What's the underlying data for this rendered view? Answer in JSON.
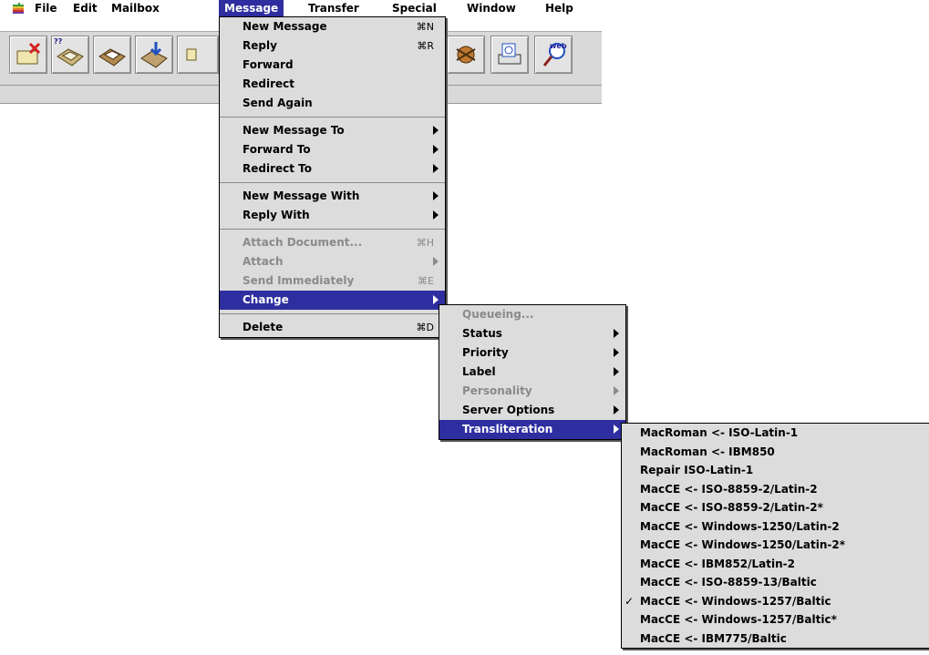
{
  "menubar": {
    "apple_icon": "apple-icon",
    "items": [
      "File",
      "Edit",
      "Mailbox",
      "Message",
      "Transfer",
      "Special",
      "Window",
      "Help"
    ],
    "active": "Message"
  },
  "toolbar": {
    "buttons": [
      {
        "icon": "trash-message-icon",
        "tag": ""
      },
      {
        "icon": "mailbox-icon",
        "tag": "??"
      },
      {
        "icon": "in-tray-icon",
        "tag": ""
      },
      {
        "icon": "download-icon",
        "tag": ""
      },
      {
        "icon": "partial-icon",
        "tag": ""
      },
      {
        "icon": "tool-icon",
        "tag": ""
      },
      {
        "icon": "preview-icon",
        "tag": ""
      },
      {
        "icon": "web-search-icon",
        "tag": "web"
      }
    ]
  },
  "message_menu": {
    "items": [
      {
        "label": "New Message",
        "shortcut": "⌘N"
      },
      {
        "label": "Reply",
        "shortcut": "⌘R"
      },
      {
        "label": "Forward",
        "shortcut": ""
      },
      {
        "label": "Redirect",
        "shortcut": ""
      },
      {
        "label": "Send Again",
        "shortcut": ""
      },
      {
        "label": "New Message To",
        "submenu": true
      },
      {
        "label": "Forward To",
        "submenu": true
      },
      {
        "label": "Redirect To",
        "submenu": true
      },
      {
        "label": "New Message With",
        "submenu": true
      },
      {
        "label": "Reply With",
        "submenu": true
      },
      {
        "label": "Attach Document...",
        "shortcut": "⌘H",
        "disabled": true
      },
      {
        "label": "Attach",
        "submenu": true,
        "disabled": true
      },
      {
        "label": "Send Immediately",
        "shortcut": "⌘E",
        "disabled": true
      },
      {
        "label": "Change",
        "submenu": true,
        "active": true
      },
      {
        "label": "Delete",
        "shortcut": "⌘D"
      }
    ]
  },
  "change_menu": {
    "items": [
      {
        "label": "Queueing...",
        "disabled": true
      },
      {
        "label": "Status",
        "submenu": true
      },
      {
        "label": "Priority",
        "submenu": true
      },
      {
        "label": "Label",
        "submenu": true
      },
      {
        "label": "Personality",
        "submenu": true,
        "disabled": true
      },
      {
        "label": "Server Options",
        "submenu": true
      },
      {
        "label": "Transliteration",
        "submenu": true,
        "active": true
      }
    ]
  },
  "transliteration_menu": {
    "items": [
      {
        "label": "MacRoman <- ISO-Latin-1"
      },
      {
        "label": "MacRoman <- IBM850"
      },
      {
        "label": "Repair ISO-Latin-1"
      },
      {
        "label": "MacCE <- ISO-8859-2/Latin-2"
      },
      {
        "label": "MacCE <- ISO-8859-2/Latin-2*"
      },
      {
        "label": "MacCE <- Windows-1250/Latin-2"
      },
      {
        "label": "MacCE <- Windows-1250/Latin-2*"
      },
      {
        "label": "MacCE <- IBM852/Latin-2"
      },
      {
        "label": "MacCE <- ISO-8859-13/Baltic"
      },
      {
        "label": "MacCE <- Windows-1257/Baltic",
        "checked": true,
        "check_mark": "✓"
      },
      {
        "label": "MacCE <- Windows-1257/Baltic*"
      },
      {
        "label": "MacCE <- IBM775/Baltic"
      }
    ]
  },
  "colors": {
    "highlight": "#2e2ea0",
    "menu_bg": "#dcdcdc",
    "disabled_text": "#8a8a8a"
  }
}
